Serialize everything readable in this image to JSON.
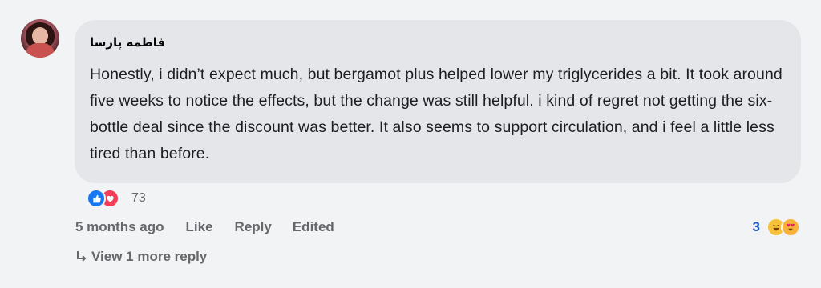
{
  "comment": {
    "author": "فاطمه پارسا",
    "text": "Honestly, i didn’t expect much, but bergamot plus helped lower my triglycerides a bit. It took around five weeks to notice the effects, but the change was still helpful. i kind of regret not getting the six-bottle deal since the discount was better. It also seems to support circulation, and i feel a little less tired than before.",
    "reactions": {
      "icons": [
        "thumbs-up-icon",
        "heart-icon"
      ],
      "count": "73"
    },
    "actions": {
      "timestamp": "5 months ago",
      "like_label": "Like",
      "reply_label": "Reply",
      "edited_label": "Edited"
    },
    "reply_reactions": {
      "count": "3",
      "icons": [
        "laughing-emoji-icon",
        "heart-eyes-emoji-icon"
      ]
    },
    "more_replies_label": "View 1 more reply"
  },
  "colors": {
    "background": "#f2f3f5",
    "bubble": "#e4e6ea",
    "secondary_text": "#65676b",
    "link_blue": "#1d55c2",
    "like_blue": "#1877f2",
    "love_red": "#f33e58"
  }
}
